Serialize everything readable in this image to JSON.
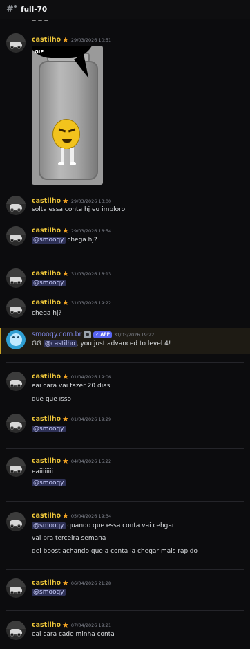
{
  "channel": {
    "name": "full-70",
    "icon": "hash-thread-icon"
  },
  "gif": {
    "label": "GIF"
  },
  "messages": [
    {
      "user": "castilho",
      "time": "29/03/2026 10:51",
      "lines": []
    },
    {
      "user": "castilho",
      "time": "29/03/2026 13:00",
      "lines": [
        "solta essa conta hj eu imploro"
      ]
    },
    {
      "user": "castilho",
      "time": "29/03/2026 18:54",
      "mention": "@smooqy",
      "lines": [
        "chega hj?"
      ]
    },
    {
      "user": "castilho",
      "time": "31/03/2026 18:13",
      "mention": "@smooqy",
      "lines": []
    },
    {
      "user": "castilho",
      "time": "31/03/2026 19:22",
      "lines": [
        "chega hj?"
      ]
    },
    {
      "user": "smooqy.com.br",
      "tag": "APP",
      "time": "31/03/2026 19:22",
      "pre": "GG",
      "mention": "@castilho",
      "lines": [
        ", you just advanced to level 4!"
      ]
    },
    {
      "user": "castilho",
      "time": "01/04/2026 19:06",
      "lines": [
        "eai cara vai fazer 20 dias",
        "que que isso"
      ]
    },
    {
      "user": "castilho",
      "time": "01/04/2026 19:29",
      "mention": "@smooqy",
      "lines": []
    },
    {
      "user": "castilho",
      "time": "04/04/2026 15:22",
      "lines": [
        "eaiiiiiiii"
      ],
      "mention": "@smooqy"
    },
    {
      "user": "castilho",
      "time": "05/04/2026 19:34",
      "mention": "@smooqy",
      "lines": [
        "quando que essa conta vai cehgar",
        "vai pra terceira semana",
        "dei boost achando que a conta ia chegar mais rapido"
      ]
    },
    {
      "user": "castilho",
      "time": "06/04/2026 21:28",
      "mention": "@smooqy",
      "lines": []
    },
    {
      "user": "castilho",
      "time": "07/04/2026 19:21",
      "lines": [
        "eai cara cade minha conta"
      ]
    }
  ],
  "colors": {
    "username": "#f0c83a",
    "bot_username": "#7f87e6",
    "mention_bg": "#2e3156",
    "star": "#f7a623",
    "background": "#0c0c0e"
  }
}
